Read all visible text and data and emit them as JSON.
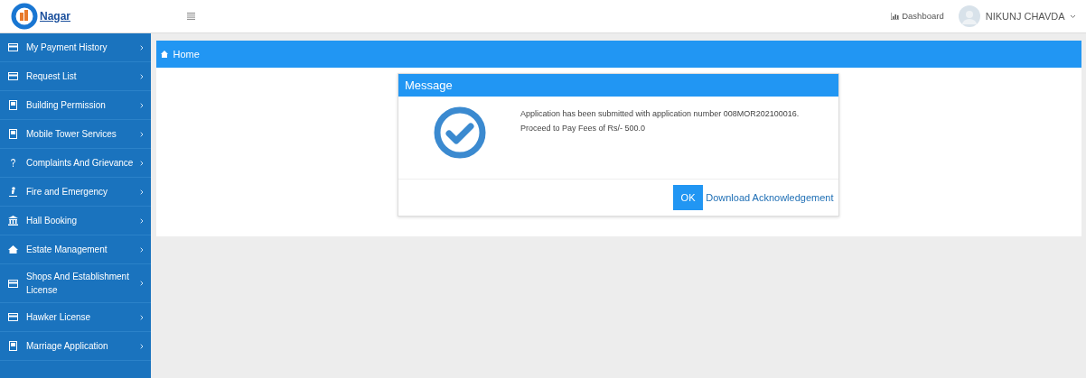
{
  "logo": {
    "text": "Nagar"
  },
  "user": {
    "dashboard": "Dashboard",
    "name": "NIKUNJ CHAVDA"
  },
  "sidebar": {
    "items": [
      {
        "label": "My Payment History",
        "kind": "card"
      },
      {
        "label": "Request List",
        "kind": "card"
      },
      {
        "label": "Building Permission",
        "kind": "building"
      },
      {
        "label": "Mobile Tower Services",
        "kind": "building"
      },
      {
        "label": "Complaints And Grievance",
        "kind": "question"
      },
      {
        "label": "Fire and Emergency",
        "kind": "fire"
      },
      {
        "label": "Hall Booking",
        "kind": "bank"
      },
      {
        "label": "Estate Management",
        "kind": "home"
      },
      {
        "label": "Shops And Establishment License",
        "kind": "card"
      },
      {
        "label": "Hawker License",
        "kind": "card"
      },
      {
        "label": "Marriage Application",
        "kind": "building"
      }
    ]
  },
  "breadcrumb": "Home",
  "dialog": {
    "title": "Message",
    "lines": [
      "Application has been submitted with application number 008MOR202100016.",
      "Proceed to Pay Fees of Rs/- 500.0"
    ],
    "ok": "OK",
    "link": "Download Acknowledgement"
  }
}
